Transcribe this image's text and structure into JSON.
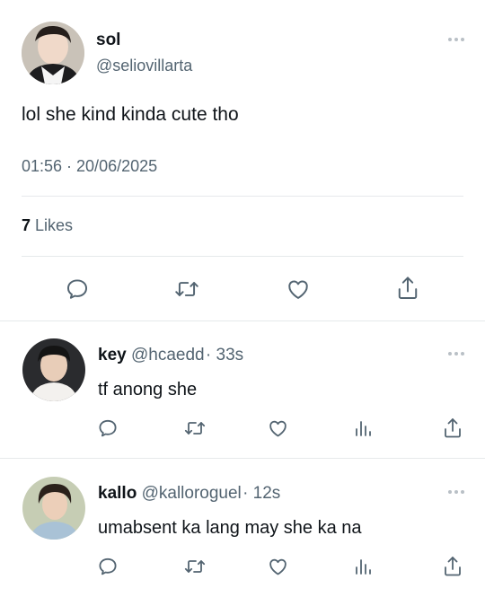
{
  "main_tweet": {
    "display_name": "sol",
    "handle": "@seliovillarta",
    "text": "lol she kind kinda cute tho",
    "timestamp": "01:56 · 20/06/2025",
    "likes_count": "7",
    "likes_label": "Likes"
  },
  "replies": [
    {
      "display_name": "key",
      "handle": "@hcaedd",
      "time": "· 33s",
      "text": "tf anong she"
    },
    {
      "display_name": "kallo",
      "handle": "@kalloroguel",
      "time": "· 12s",
      "text": "umabsent ka lang may she ka na"
    }
  ],
  "colors": {
    "text": "#0f1419",
    "muted": "#536471",
    "divider": "#e6e9eb"
  },
  "icons": [
    "more-icon",
    "reply-icon",
    "retweet-icon",
    "like-icon",
    "views-icon",
    "share-icon"
  ]
}
